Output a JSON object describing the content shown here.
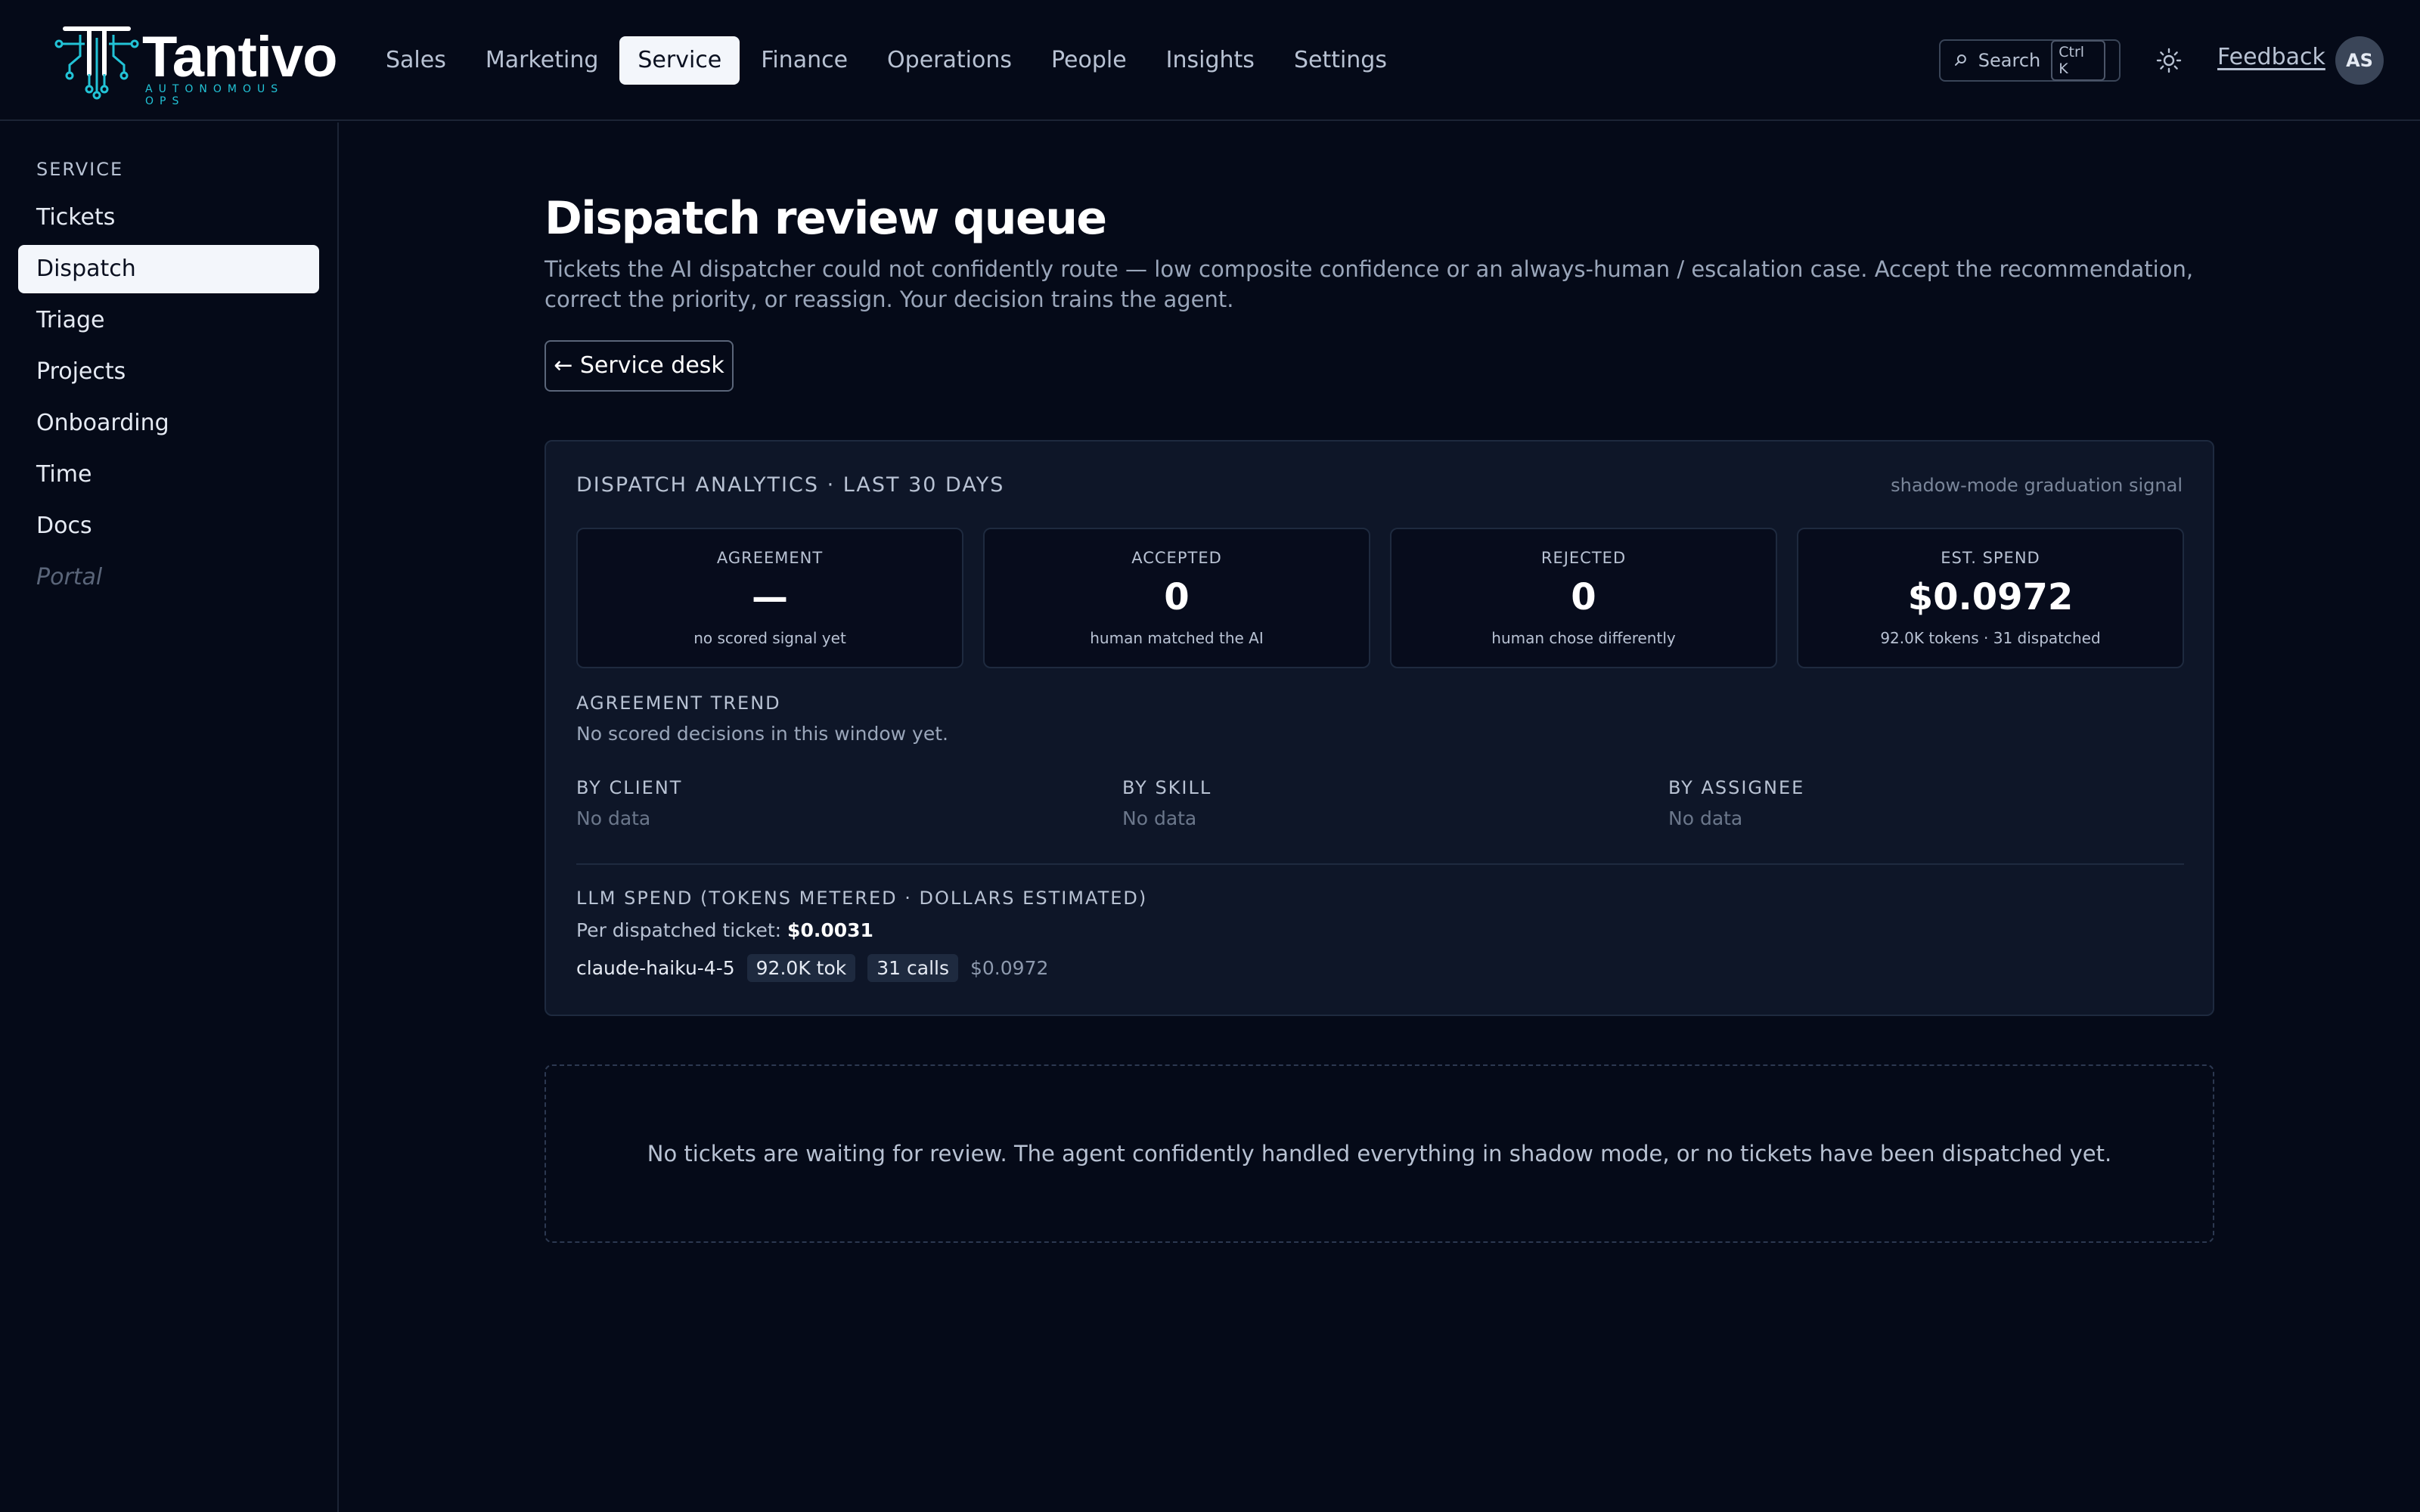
{
  "brand": {
    "name": "Tantivo",
    "tagline": "AUTONOMOUS OPS",
    "accent": "#22c3d6"
  },
  "topnav": {
    "items": [
      "Sales",
      "Marketing",
      "Service",
      "Finance",
      "Operations",
      "People",
      "Insights",
      "Settings"
    ],
    "active": "Service"
  },
  "search": {
    "label": "Search",
    "shortcut": "Ctrl K",
    "icon": "search-icon"
  },
  "theme_toggle_icon": "sun-icon",
  "feedback_label": "Feedback",
  "user_initials": "AS",
  "sidebar": {
    "heading": "SERVICE",
    "items": [
      {
        "label": "Tickets"
      },
      {
        "label": "Dispatch"
      },
      {
        "label": "Triage"
      },
      {
        "label": "Projects"
      },
      {
        "label": "Onboarding"
      },
      {
        "label": "Time"
      },
      {
        "label": "Docs"
      },
      {
        "label": "Portal"
      }
    ],
    "active": "Dispatch",
    "disabled": "Portal"
  },
  "page": {
    "title": "Dispatch review queue",
    "description": "Tickets the AI dispatcher could not confidently route — low composite confidence or an always-human / escalation case. Accept the recommendation, correct the priority, or reassign. Your decision trains the agent.",
    "back_label": "← Service desk"
  },
  "analytics": {
    "title": "DISPATCH ANALYTICS · LAST 30 DAYS",
    "hint": "shadow-mode graduation signal",
    "stats": [
      {
        "label": "AGREEMENT",
        "value": "—",
        "sub": "no scored signal yet"
      },
      {
        "label": "ACCEPTED",
        "value": "0",
        "sub": "human matched the AI"
      },
      {
        "label": "REJECTED",
        "value": "0",
        "sub": "human chose differently"
      },
      {
        "label": "EST. SPEND",
        "value": "$0.0972",
        "sub": "92.0K tokens · 31 dispatched"
      }
    ],
    "trend": {
      "label": "AGREEMENT TREND",
      "text": "No scored decisions in this window yet."
    },
    "breakdowns": [
      {
        "label": "BY CLIENT",
        "value": "No data"
      },
      {
        "label": "BY SKILL",
        "value": "No data"
      },
      {
        "label": "BY ASSIGNEE",
        "value": "No data"
      }
    ],
    "llm": {
      "label": "LLM SPEND (TOKENS METERED · DOLLARS ESTIMATED)",
      "per_ticket_label": "Per dispatched ticket:",
      "per_ticket_value": "$0.0031",
      "model": "claude-haiku-4-5",
      "tokens": "92.0K tok",
      "calls": "31 calls",
      "cost": "$0.0972"
    }
  },
  "empty_queue_message": "No tickets are waiting for review. The agent confidently handled everything in shadow mode, or no tickets have been dispatched yet."
}
